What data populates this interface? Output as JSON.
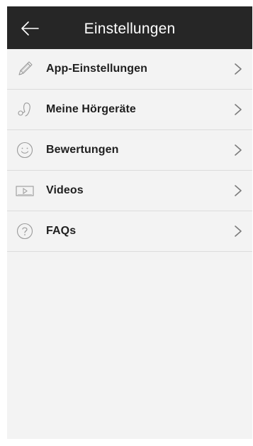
{
  "header": {
    "title": "Einstellungen"
  },
  "menu": {
    "items": [
      {
        "label": "App-Einstellungen",
        "icon": "pencil-icon"
      },
      {
        "label": "Meine Hörgeräte",
        "icon": "hearing-aid-icon"
      },
      {
        "label": "Bewertungen",
        "icon": "smiley-icon"
      },
      {
        "label": "Videos",
        "icon": "video-play-icon"
      },
      {
        "label": "FAQs",
        "icon": "question-circle-icon"
      }
    ]
  },
  "colors": {
    "header_bg": "#262626",
    "background": "#f3f3f3",
    "divider": "#dcdcdc",
    "icon_gray": "#9a9a9a"
  }
}
